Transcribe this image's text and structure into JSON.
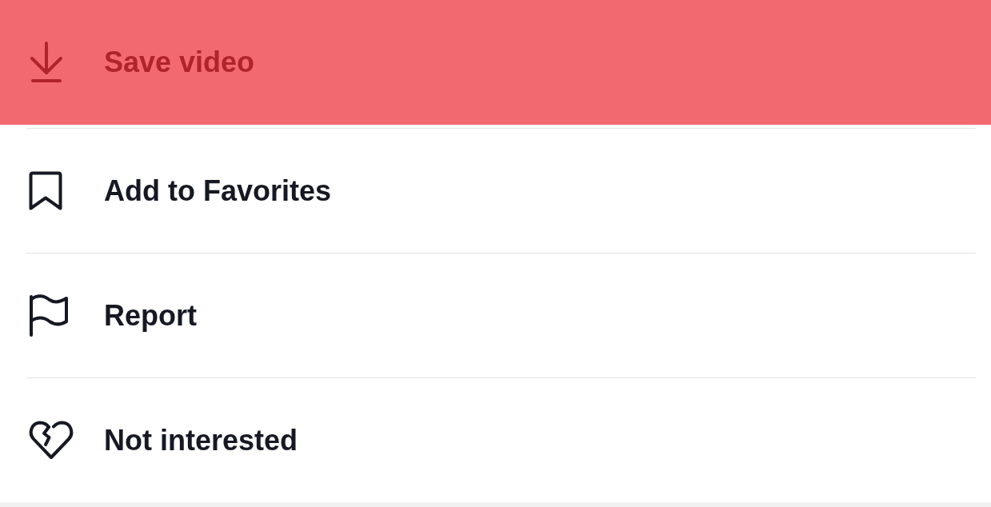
{
  "menu": {
    "items": [
      {
        "label": "Save video",
        "selected": true
      },
      {
        "label": "Add to Favorites",
        "selected": false
      },
      {
        "label": "Report",
        "selected": false
      },
      {
        "label": "Not interested",
        "selected": false
      }
    ]
  }
}
